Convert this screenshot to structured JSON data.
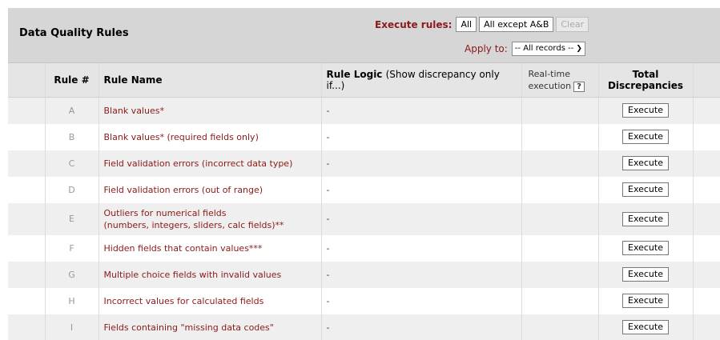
{
  "header": {
    "title": "Data Quality Rules",
    "execute_label": "Execute rules:",
    "buttons": {
      "all": "All",
      "all_except": "All except A&B",
      "clear": "Clear"
    },
    "apply_label": "Apply to:",
    "apply_select": "-- All records --"
  },
  "columns": {
    "rule_num": "Rule #",
    "rule_name": "Rule Name",
    "rule_logic": "Rule Logic",
    "rule_logic_sub": "(Show discrepancy only if...)",
    "realtime_1": "Real-time",
    "realtime_2": "execution",
    "help": "?",
    "total_1": "Total",
    "total_2": "Discrepancies"
  },
  "rows": [
    {
      "letter": "A",
      "name": "Blank values*",
      "logic": "-",
      "action": "Execute"
    },
    {
      "letter": "B",
      "name": "Blank values* (required fields only)",
      "logic": "-",
      "action": "Execute"
    },
    {
      "letter": "C",
      "name": "Field validation errors (incorrect data type)",
      "logic": "-",
      "action": "Execute"
    },
    {
      "letter": "D",
      "name": "Field validation errors (out of range)",
      "logic": "-",
      "action": "Execute"
    },
    {
      "letter": "E",
      "name": "Outliers for numerical fields",
      "name2": "(numbers, integers, sliders, calc fields)**",
      "logic": "-",
      "action": "Execute"
    },
    {
      "letter": "F",
      "name": "Hidden fields that contain values***",
      "logic": "-",
      "action": "Execute"
    },
    {
      "letter": "G",
      "name": "Multiple choice fields with invalid values",
      "logic": "-",
      "action": "Execute"
    },
    {
      "letter": "H",
      "name": "Incorrect values for calculated fields",
      "logic": "-",
      "action": "Execute"
    },
    {
      "letter": "I",
      "name": "Fields containing \"missing data codes\"",
      "logic": "-",
      "action": "Execute"
    }
  ]
}
